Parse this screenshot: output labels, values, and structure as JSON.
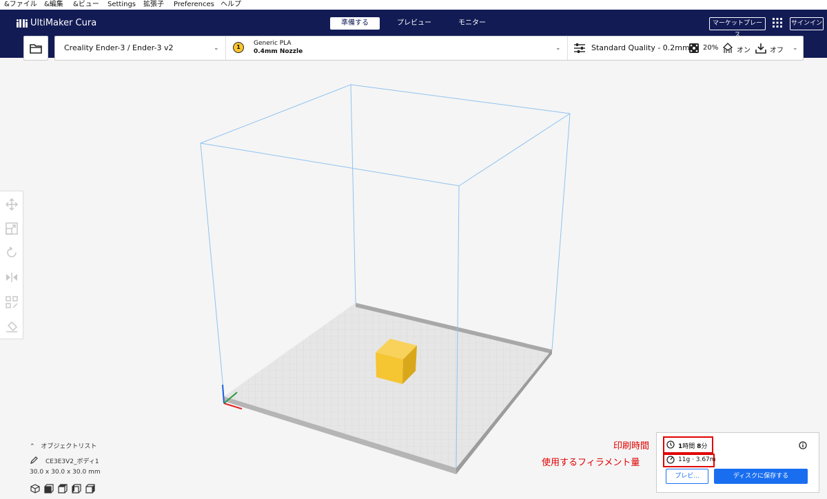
{
  "menu": [
    "&ファイル",
    "&編集",
    "&ビュー",
    "Settings",
    "拡張子",
    "Preferences",
    "ヘルプ"
  ],
  "app": {
    "title": "UltiMaker Cura"
  },
  "stages": [
    {
      "label": "準備する",
      "active": true
    },
    {
      "label": "プレビュー",
      "active": false
    },
    {
      "label": "モニター",
      "active": false
    }
  ],
  "header": {
    "marketplace": "マーケットプレース",
    "signin": "サインイン"
  },
  "printer": {
    "name": "Creality Ender-3 / Ender-3 v2"
  },
  "extruder": {
    "number": "1",
    "material": "Generic PLA",
    "nozzle": "0.4mm Nozzle",
    "color": "#f7c52d"
  },
  "print_settings": {
    "quality": "Standard Quality - 0.2mm",
    "infill": "20%",
    "support": "オン",
    "adhesion": "オフ"
  },
  "object_list": {
    "label": "オブジェクトリスト",
    "object_name": "CE3E3V2_ボディ1",
    "dimensions": "30.0 x 30.0 x 30.0 mm"
  },
  "summary": {
    "time_hours": "1",
    "time_hours_unit": "時間",
    "time_minutes": "8",
    "time_minutes_unit": "分",
    "material": "11g · 3.67m",
    "preview_button": "プレビ...",
    "save_button": "ディスクに保存する"
  },
  "annotations": {
    "time": "印刷時間",
    "filament": "使用するフィラメント量"
  },
  "colors": {
    "header": "#121b54",
    "accent": "#196ef0",
    "highlight": "#e00000",
    "model": "#f7c52d"
  },
  "icons": [
    "folder-icon",
    "apps-grid-icon",
    "quality-sliders-icon",
    "infill-icon",
    "support-icon",
    "adhesion-icon",
    "info-icon",
    "clock-icon",
    "filament-icon",
    "edit-icon"
  ]
}
